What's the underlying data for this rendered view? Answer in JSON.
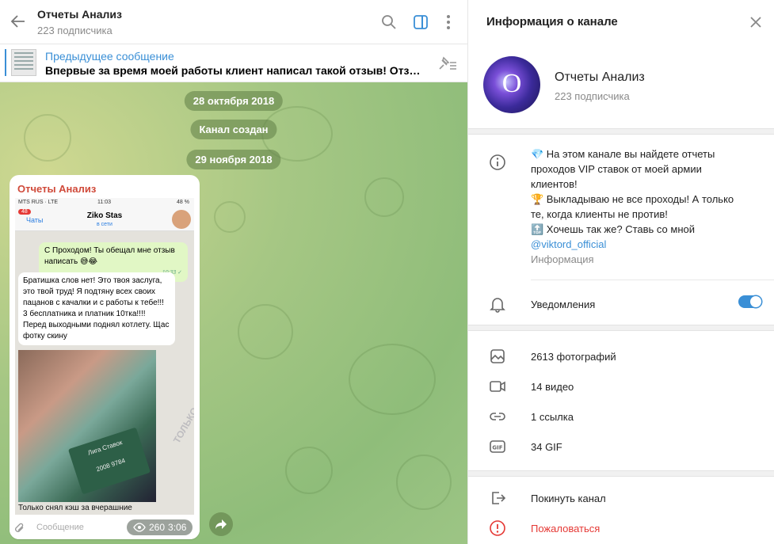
{
  "chat": {
    "title": "Отчеты Анализ",
    "subtitle": "223 подписчика",
    "pinned_label": "Предыдущее сообщение",
    "pinned_text": "Впервые за время моей работы клиент написал такой отзыв! Отзывы ...",
    "dates": [
      "28 октября 2018",
      "Канал создан",
      "29 ноября 2018"
    ],
    "message": {
      "author": "Отчеты Анализ",
      "views": "260",
      "time": "3:06",
      "compose_placeholder": "Сообщение",
      "screenshot": {
        "status_left": "MTS RUS · LTE",
        "status_time": "11:03",
        "status_right": "48 %",
        "badge": "48",
        "back_label": "Чаты",
        "contact": "Ziko Stas",
        "contact_status": "в сети",
        "out_text": "С Проходом! Ты обещал мне отзыв написать 😅😂",
        "out_time": "10:33 ✓",
        "in_text": "Братишка слов нет! Это твоя заслуга, это твой труд! Я подтяну всех своих пацанов с качалки и с работы к тебе!!! 3 бесплатника и платник 10тка!!!! Перед выходными поднял котлету. Щас фотку скину",
        "card_title": "Лига Ставок",
        "card_number": "2008 9784",
        "caption": "Только снял кэш за вчерашние",
        "watermark": "ТОЛЬКО В TELEGRAM @BET_VITAL"
      }
    }
  },
  "info": {
    "header": "Информация о канале",
    "avatar_letter": "O",
    "name": "Отчеты Анализ",
    "subscribers": "223 подписчика",
    "description": [
      "💎 На этом канале вы найдете отчеты проходов VIP ставок от моей армии клиентов!",
      "🏆 Выкладываю не все проходы! А только те, когда клиенты не против!",
      "🔝 Хочешь так же? Ставь со мной"
    ],
    "link": "@viktord_official",
    "description_caption": "Информация",
    "notifications_label": "Уведомления",
    "notifications_on": true,
    "media": {
      "photos": "2613 фотографий",
      "videos": "14 видео",
      "links": "1 ссылка",
      "gifs": "34 GIF"
    },
    "leave": "Покинуть канал",
    "report": "Пожаловаться"
  },
  "colors": {
    "accent": "#3a8fd6",
    "danger": "#e53935",
    "author": "#d04a3a"
  }
}
